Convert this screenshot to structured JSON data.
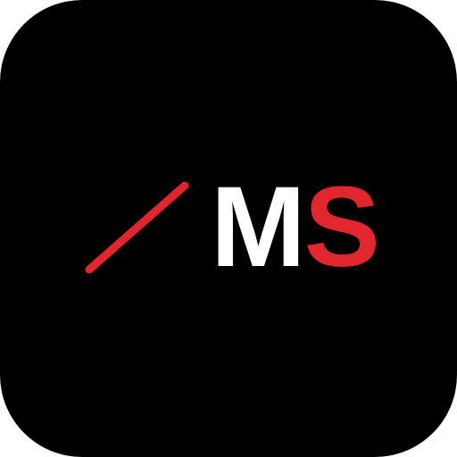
{
  "logo": {
    "letter_first": "M",
    "letter_second": "S",
    "colors": {
      "background": "#000000",
      "letter_first": "#ffffff",
      "accent": "#e1262d"
    },
    "mark_icon": "red-diagonal-slash-icon"
  }
}
